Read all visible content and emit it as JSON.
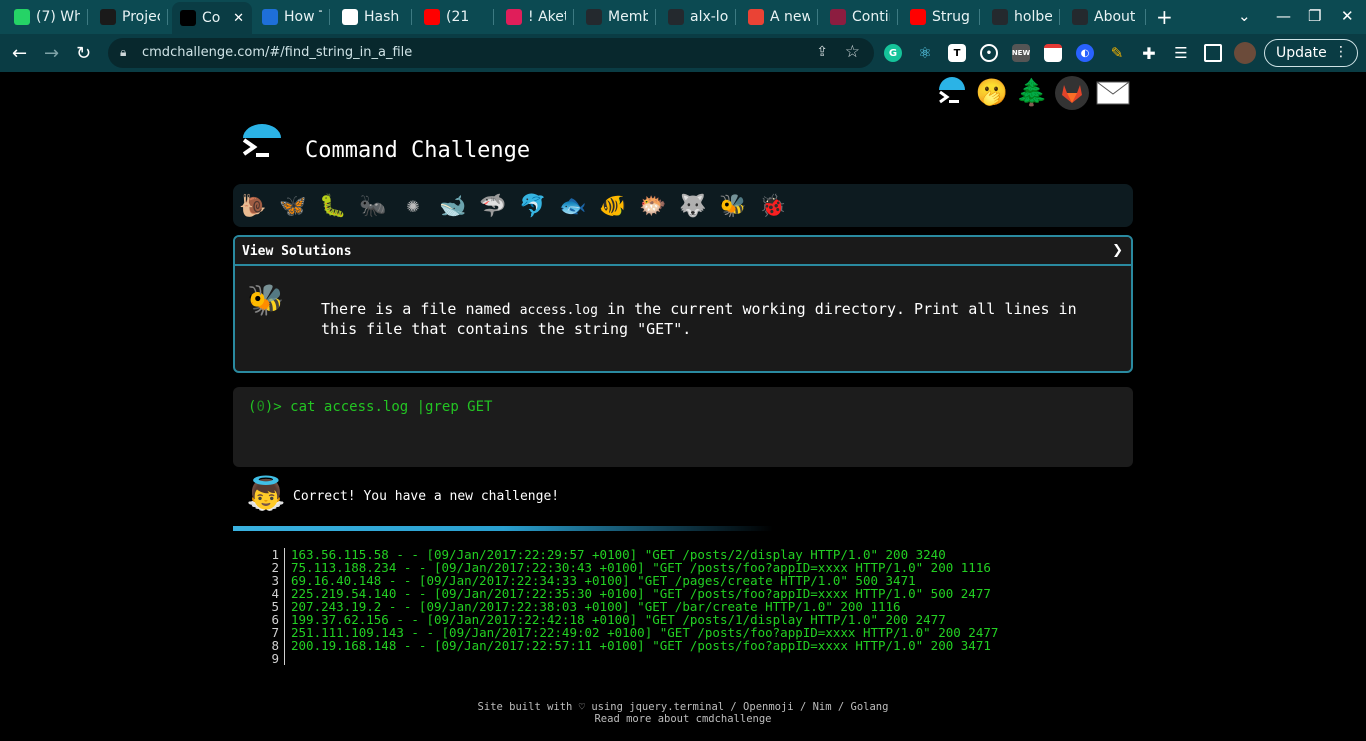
{
  "browser": {
    "tabs": [
      {
        "title": "(7) Wh",
        "favicon": "whatsapp-icon",
        "color": "#25d366"
      },
      {
        "title": "Projec",
        "favicon": "alx-icon",
        "color": "#1a1a1a"
      },
      {
        "title": "Co",
        "favicon": "terminal-icon",
        "color": "#000000",
        "active": true
      },
      {
        "title": "How T",
        "favicon": "codeium-icon",
        "color": "#1e6fd9"
      },
      {
        "title": "Hash",
        "favicon": "wikipedia-icon",
        "color": "#ffffff"
      },
      {
        "title": "(21",
        "favicon": "youtube-icon",
        "color": "#ff0000"
      },
      {
        "title": "! Aketi",
        "favicon": "slack-icon",
        "color": "#e01e5a"
      },
      {
        "title": "Memb",
        "favicon": "github-icon",
        "color": "#24292e"
      },
      {
        "title": "alx-lo",
        "favicon": "github-icon",
        "color": "#24292e"
      },
      {
        "title": "A new",
        "favicon": "gmail-icon",
        "color": "#ea4335"
      },
      {
        "title": "Contin",
        "favicon": "asu-icon",
        "color": "#8c1d40"
      },
      {
        "title": "Strug",
        "favicon": "youtube-icon",
        "color": "#ff0000"
      },
      {
        "title": "holber",
        "favicon": "github-icon",
        "color": "#24292e"
      },
      {
        "title": "About",
        "favicon": "github-icon",
        "color": "#24292e"
      }
    ],
    "url": "cmdchallenge.com/#/find_string_in_a_file",
    "update_label": "Update"
  },
  "site": {
    "title": "Command Challenge"
  },
  "solutions": {
    "label": "View Solutions",
    "chevron": "❯"
  },
  "task": {
    "text_before": "There is a file named ",
    "code": "access.log",
    "text_after": " in the current working directory. Print all lines in this file that contains the string \"GET\"."
  },
  "terminal": {
    "status_open": "(",
    "status_code": "0",
    "status_close": ")> ",
    "command": "cat access.log |grep GET"
  },
  "result": {
    "message": "Correct! You have a new challenge!"
  },
  "output": {
    "lines": [
      {
        "num": "1",
        "text": "163.56.115.58 - - [09/Jan/2017:22:29:57 +0100] \"GET /posts/2/display HTTP/1.0\" 200 3240"
      },
      {
        "num": "2",
        "text": "75.113.188.234 - - [09/Jan/2017:22:30:43 +0100] \"GET /posts/foo?appID=xxxx HTTP/1.0\" 200 1116"
      },
      {
        "num": "3",
        "text": "69.16.40.148 - - [09/Jan/2017:22:34:33 +0100] \"GET /pages/create HTTP/1.0\" 500 3471"
      },
      {
        "num": "4",
        "text": "225.219.54.140 - - [09/Jan/2017:22:35:30 +0100] \"GET /posts/foo?appID=xxxx HTTP/1.0\" 500 2477"
      },
      {
        "num": "5",
        "text": "207.243.19.2 - - [09/Jan/2017:22:38:03 +0100] \"GET /bar/create HTTP/1.0\" 200 1116"
      },
      {
        "num": "6",
        "text": "199.37.62.156 - - [09/Jan/2017:22:42:18 +0100] \"GET /posts/1/display HTTP/1.0\" 200 2477"
      },
      {
        "num": "7",
        "text": "251.111.109.143 - - [09/Jan/2017:22:49:02 +0100] \"GET /posts/foo?appID=xxxx HTTP/1.0\" 200 2477"
      },
      {
        "num": "8",
        "text": "200.19.168.148 - - [09/Jan/2017:22:57:11 +0100] \"GET /posts/foo?appID=xxxx HTTP/1.0\" 200 3471"
      },
      {
        "num": "9",
        "text": ""
      }
    ]
  },
  "footer": {
    "line1": "Site built with ♡ using jquery.terminal / Openmoji / Nim / Golang",
    "line2": "Read more about cmdchallenge"
  },
  "colors": {
    "tabstrip": "#0c4a52",
    "toolbar": "#0a3c44",
    "accent": "#2a8aa0",
    "terminal_green": "#23c423"
  }
}
